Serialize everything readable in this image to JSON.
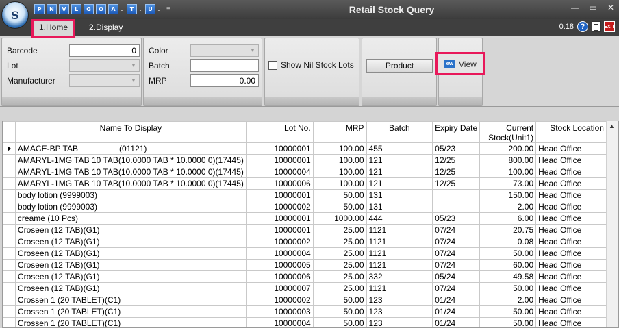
{
  "window": {
    "title": "Retail Stock Query",
    "logo_letter": "S",
    "controls": {
      "minimize": "—",
      "restore": "▭",
      "close": "✕"
    }
  },
  "quick_access": [
    {
      "letter": "P"
    },
    {
      "letter": "N"
    },
    {
      "letter": "V"
    },
    {
      "letter": "L"
    },
    {
      "letter": "G"
    },
    {
      "letter": "O"
    },
    {
      "letter": "A"
    },
    {
      "letter": "T"
    },
    {
      "letter": "U"
    }
  ],
  "tabs": {
    "home": "1.Home",
    "display": "2.Display"
  },
  "status": {
    "version": "0.18",
    "help": "?",
    "exit": "EXIT"
  },
  "filters": {
    "barcode_label": "Barcode",
    "barcode_value": "0",
    "lot_label": "Lot",
    "manufacturer_label": "Manufacturer",
    "color_label": "Color",
    "batch_label": "Batch",
    "batch_value": "",
    "mrp_label": "MRP",
    "mrp_value": "0.00",
    "show_nil_label": "Show Nil Stock Lots",
    "product_label": "Product",
    "view_label": "View",
    "view_icon": "eW"
  },
  "grid": {
    "columns": [
      "Name To Display",
      "Lot No.",
      "MRP",
      "Batch",
      "Expiry Date",
      "Current\nStock(Unit1)",
      "Stock Location"
    ],
    "rows": [
      [
        "AMACE-BP TAB                  (01121)",
        "10000001",
        "100.00",
        "455",
        "05/23",
        "200.00",
        "Head Office"
      ],
      [
        "AMARYL-1MG TAB 10 TAB(10.0000 TAB * 10.0000 0)(17445)",
        "10000001",
        "100.00",
        "121",
        "12/25",
        "800.00",
        "Head Office"
      ],
      [
        "AMARYL-1MG TAB 10 TAB(10.0000 TAB * 10.0000 0)(17445)",
        "10000004",
        "100.00",
        "121",
        "12/25",
        "100.00",
        "Head Office"
      ],
      [
        "AMARYL-1MG TAB 10 TAB(10.0000 TAB * 10.0000 0)(17445)",
        "10000006",
        "100.00",
        "121",
        "12/25",
        "73.00",
        "Head Office"
      ],
      [
        "body lotion (9999003)",
        "10000001",
        "50.00",
        "131",
        "",
        "150.00",
        "Head Office"
      ],
      [
        "body lotion (9999003)",
        "10000002",
        "50.00",
        "131",
        "",
        "2.00",
        "Head Office"
      ],
      [
        "creame (10 Pcs)",
        "10000001",
        "1000.00",
        "444",
        "05/23",
        "6.00",
        "Head Office"
      ],
      [
        "Croseen (12 TAB)(G1)",
        "10000001",
        "25.00",
        "1121",
        "07/24",
        "20.75",
        "Head Office"
      ],
      [
        "Croseen (12 TAB)(G1)",
        "10000002",
        "25.00",
        "1121",
        "07/24",
        "0.08",
        "Head Office"
      ],
      [
        "Croseen (12 TAB)(G1)",
        "10000004",
        "25.00",
        "1121",
        "07/24",
        "50.00",
        "Head Office"
      ],
      [
        "Croseen (12 TAB)(G1)",
        "10000005",
        "25.00",
        "1121",
        "07/24",
        "60.00",
        "Head Office"
      ],
      [
        "Croseen (12 TAB)(G1)",
        "10000006",
        "25.00",
        "332",
        "05/24",
        "49.58",
        "Head Office"
      ],
      [
        "Croseen (12 TAB)(G1)",
        "10000007",
        "25.00",
        "1121",
        "07/24",
        "50.00",
        "Head Office"
      ],
      [
        "Crossen 1 (20 TABLET)(C1)",
        "10000002",
        "50.00",
        "123",
        "01/24",
        "2.00",
        "Head Office"
      ],
      [
        "Crossen 1 (20 TABLET)(C1)",
        "10000003",
        "50.00",
        "123",
        "01/24",
        "50.00",
        "Head Office"
      ],
      [
        "Crossen 1 (20 TABLET)(C1)",
        "10000004",
        "50.00",
        "123",
        "01/24",
        "50.00",
        "Head Office"
      ]
    ]
  },
  "colors": {
    "highlight": "#e8185a",
    "titlebar": "#3c3c3c",
    "accent": "#1f62c2"
  }
}
